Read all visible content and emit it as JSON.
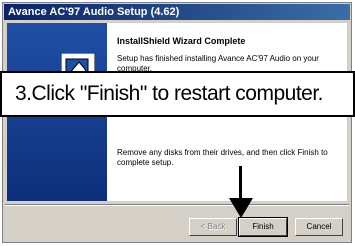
{
  "window": {
    "title": "Avance AC'97 Audio Setup (4.62)"
  },
  "wizard": {
    "heading": "InstallShield Wizard Complete",
    "message": "Setup has finished installing Avance AC'97 Audio on your computer.",
    "message2": "Remove any disks from their drives, and then click Finish to complete setup."
  },
  "buttons": {
    "back": "< Back",
    "finish": "Finish",
    "cancel": "Cancel"
  },
  "callout": {
    "text": "3.Click \"Finish\" to restart computer."
  },
  "colors": {
    "titlebar": "#0a246a",
    "panel": "#1f4fa6",
    "face": "#d4d0c8"
  },
  "icons": {
    "installshield": "installshield-logo-icon",
    "arrow": "arrow-down-icon"
  }
}
